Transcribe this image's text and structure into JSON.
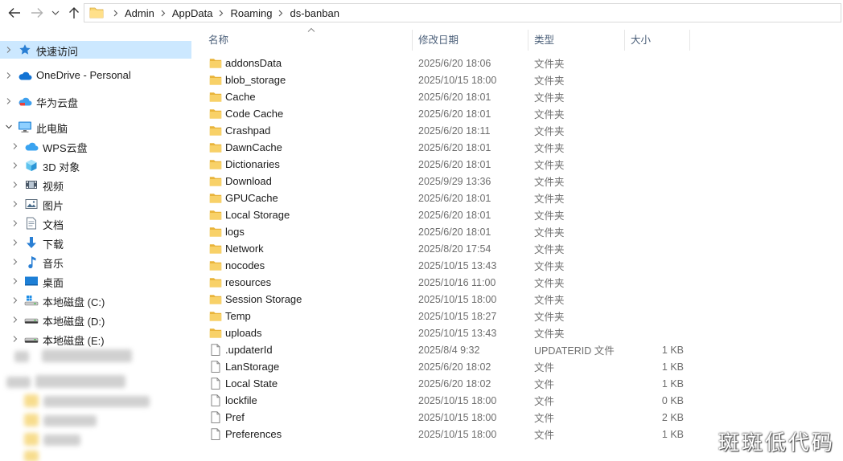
{
  "nav": {
    "back": "back-arrow",
    "forward": "forward-arrow",
    "recent": "chevron-down",
    "up": "up-arrow"
  },
  "address": {
    "crumbs": [
      "Admin",
      "AppData",
      "Roaming",
      "ds-banban"
    ]
  },
  "sidebar": {
    "items": [
      {
        "label": "快速访问",
        "icon": "star-icon",
        "indent": 0,
        "selected": true
      },
      {
        "label": "OneDrive - Personal",
        "icon": "cloud-icon",
        "indent": 0
      },
      {
        "label": "华为云盘",
        "icon": "huawei-cloud-icon",
        "indent": 0
      },
      {
        "label": "此电脑",
        "icon": "computer-icon",
        "indent": 0,
        "expanded": true
      },
      {
        "label": "WPS云盘",
        "icon": "wps-cloud-icon",
        "indent": 1
      },
      {
        "label": "3D 对象",
        "icon": "cube-icon",
        "indent": 1
      },
      {
        "label": "视频",
        "icon": "video-icon",
        "indent": 1
      },
      {
        "label": "图片",
        "icon": "picture-icon",
        "indent": 1
      },
      {
        "label": "文档",
        "icon": "document-icon",
        "indent": 1
      },
      {
        "label": "下载",
        "icon": "download-icon",
        "indent": 1
      },
      {
        "label": "音乐",
        "icon": "music-icon",
        "indent": 1
      },
      {
        "label": "桌面",
        "icon": "desktop-icon",
        "indent": 1
      },
      {
        "label": "本地磁盘 (C:)",
        "icon": "drive-c-icon",
        "indent": 1
      },
      {
        "label": "本地磁盘 (D:)",
        "icon": "drive-icon",
        "indent": 1
      },
      {
        "label": "本地磁盘 (E:)",
        "icon": "drive-icon",
        "indent": 1
      }
    ]
  },
  "columns": {
    "name": "名称",
    "date": "修改日期",
    "type": "类型",
    "size": "大小"
  },
  "files": [
    {
      "name": "addonsData",
      "date": "2025/6/20 18:06",
      "type": "文件夹",
      "size": "",
      "kind": "folder"
    },
    {
      "name": "blob_storage",
      "date": "2025/10/15 18:00",
      "type": "文件夹",
      "size": "",
      "kind": "folder"
    },
    {
      "name": "Cache",
      "date": "2025/6/20 18:01",
      "type": "文件夹",
      "size": "",
      "kind": "folder"
    },
    {
      "name": "Code Cache",
      "date": "2025/6/20 18:01",
      "type": "文件夹",
      "size": "",
      "kind": "folder"
    },
    {
      "name": "Crashpad",
      "date": "2025/6/20 18:11",
      "type": "文件夹",
      "size": "",
      "kind": "folder"
    },
    {
      "name": "DawnCache",
      "date": "2025/6/20 18:01",
      "type": "文件夹",
      "size": "",
      "kind": "folder"
    },
    {
      "name": "Dictionaries",
      "date": "2025/6/20 18:01",
      "type": "文件夹",
      "size": "",
      "kind": "folder"
    },
    {
      "name": "Download",
      "date": "2025/9/29 13:36",
      "type": "文件夹",
      "size": "",
      "kind": "folder"
    },
    {
      "name": "GPUCache",
      "date": "2025/6/20 18:01",
      "type": "文件夹",
      "size": "",
      "kind": "folder"
    },
    {
      "name": "Local Storage",
      "date": "2025/6/20 18:01",
      "type": "文件夹",
      "size": "",
      "kind": "folder"
    },
    {
      "name": "logs",
      "date": "2025/6/20 18:01",
      "type": "文件夹",
      "size": "",
      "kind": "folder"
    },
    {
      "name": "Network",
      "date": "2025/8/20 17:54",
      "type": "文件夹",
      "size": "",
      "kind": "folder"
    },
    {
      "name": "nocodes",
      "date": "2025/10/15 13:43",
      "type": "文件夹",
      "size": "",
      "kind": "folder"
    },
    {
      "name": "resources",
      "date": "2025/10/16 11:00",
      "type": "文件夹",
      "size": "",
      "kind": "folder"
    },
    {
      "name": "Session Storage",
      "date": "2025/10/15 18:00",
      "type": "文件夹",
      "size": "",
      "kind": "folder"
    },
    {
      "name": "Temp",
      "date": "2025/10/15 18:27",
      "type": "文件夹",
      "size": "",
      "kind": "folder"
    },
    {
      "name": "uploads",
      "date": "2025/10/15 13:43",
      "type": "文件夹",
      "size": "",
      "kind": "folder"
    },
    {
      "name": ".updaterId",
      "date": "2025/8/4 9:32",
      "type": "UPDATERID 文件",
      "size": "1 KB",
      "kind": "file"
    },
    {
      "name": "LanStorage",
      "date": "2025/6/20 18:02",
      "type": "文件",
      "size": "1 KB",
      "kind": "file"
    },
    {
      "name": "Local State",
      "date": "2025/6/20 18:02",
      "type": "文件",
      "size": "1 KB",
      "kind": "file"
    },
    {
      "name": "lockfile",
      "date": "2025/10/15 18:00",
      "type": "文件",
      "size": "0 KB",
      "kind": "file"
    },
    {
      "name": "Pref",
      "date": "2025/10/15 18:00",
      "type": "文件",
      "size": "2 KB",
      "kind": "file"
    },
    {
      "name": "Preferences",
      "date": "2025/10/15 18:00",
      "type": "文件",
      "size": "1 KB",
      "kind": "file"
    }
  ],
  "watermark": "斑斑低代码",
  "colors": {
    "selection": "#cce8ff",
    "folder": "#f3c34f",
    "header_text": "#4c607a"
  }
}
